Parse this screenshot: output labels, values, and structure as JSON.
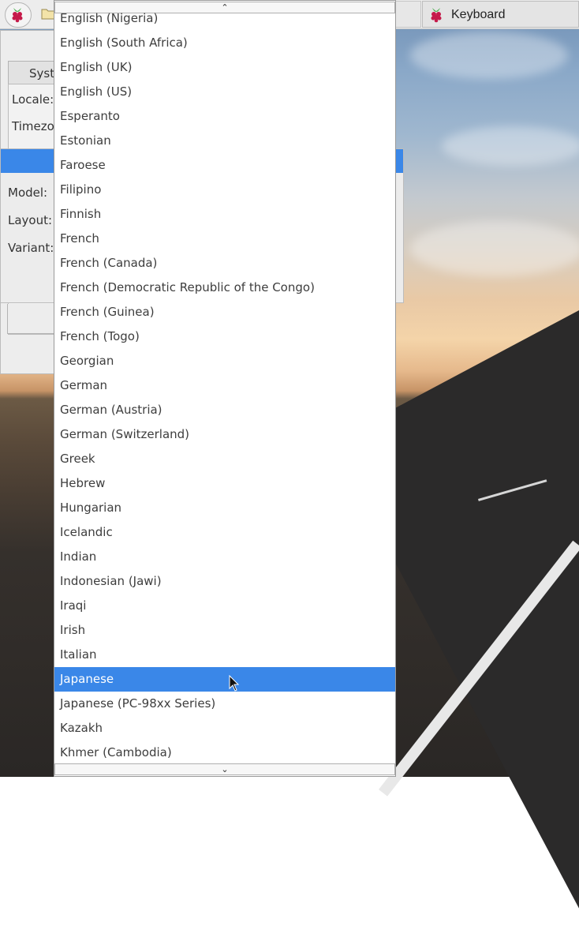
{
  "taskbar": {
    "app_label": "Keyboard",
    "icons": [
      "raspberry-menu-icon",
      "folder-icon",
      "raspberry-app-icon"
    ]
  },
  "config_window": {
    "tab_label": "Syst",
    "locale_label": "Locale:",
    "timezone_label": "Timezo"
  },
  "keyboard_dialog": {
    "model_label": "Model:",
    "layout_label": "Layout:",
    "variant_label": "Variant:"
  },
  "dropdown": {
    "scroll_up": "⌃",
    "scroll_down": "⌄",
    "selected": "Japanese",
    "items": [
      "English (Nigeria)",
      "English (South Africa)",
      "English (UK)",
      "English (US)",
      "Esperanto",
      "Estonian",
      "Faroese",
      "Filipino",
      "Finnish",
      "French",
      "French (Canada)",
      "French (Democratic Republic of the Congo)",
      "French (Guinea)",
      "French (Togo)",
      "Georgian",
      "German",
      "German (Austria)",
      "German (Switzerland)",
      "Greek",
      "Hebrew",
      "Hungarian",
      "Icelandic",
      "Indian",
      "Indonesian (Jawi)",
      "Iraqi",
      "Irish",
      "Italian",
      "Japanese",
      "Japanese (PC-98xx Series)",
      "Kazakh",
      "Khmer (Cambodia)"
    ]
  },
  "colors": {
    "selection": "#3a87e8",
    "title_bar": "#3a87e8"
  }
}
